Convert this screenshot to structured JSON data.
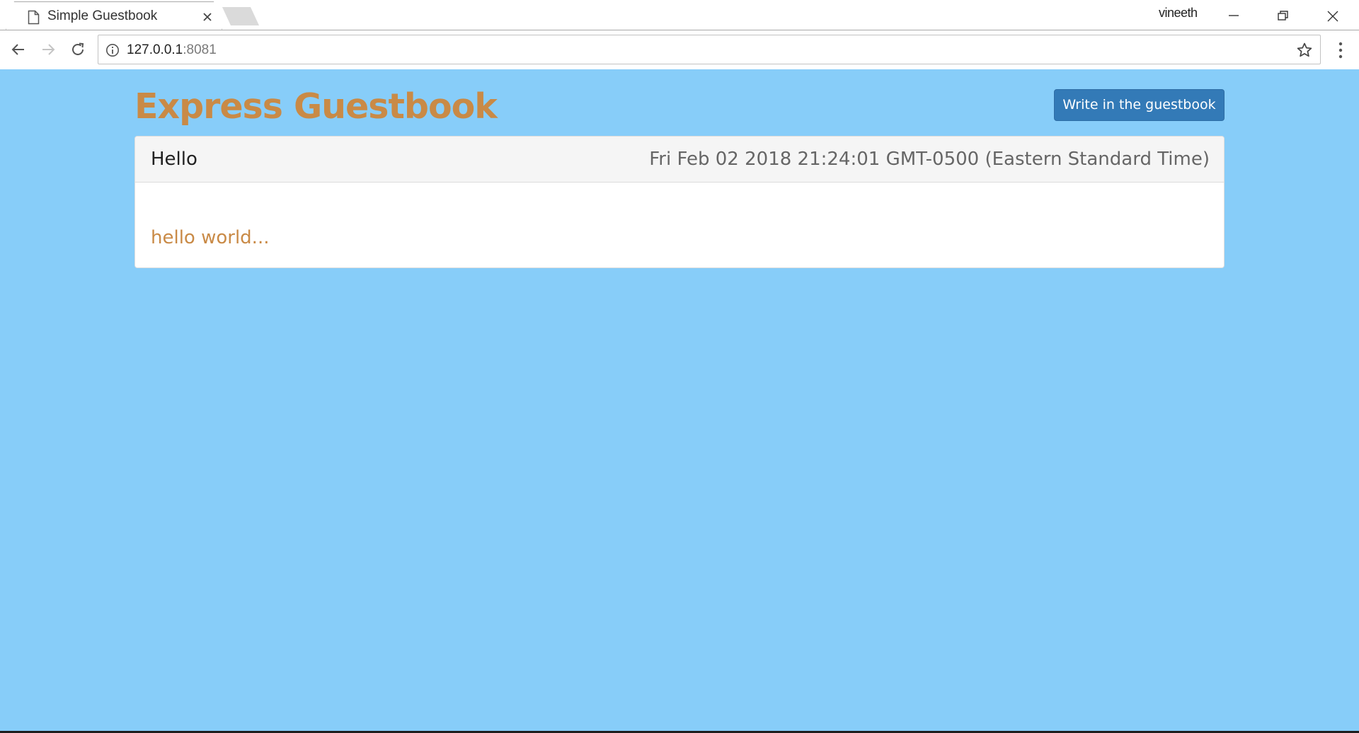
{
  "browser": {
    "tab": {
      "title": "Simple Guestbook"
    },
    "profile_name": "vineeth",
    "address": {
      "host": "127.0.0.1",
      "port": ":8081"
    }
  },
  "page": {
    "title": "Express Guestbook",
    "write_button_label": "Write in the guestbook",
    "entries": [
      {
        "title": "Hello",
        "date": "Fri Feb 02 2018 21:24:01 GMT-0500 (Eastern Standard Time)",
        "body": "hello world..."
      }
    ]
  },
  "colors": {
    "page_background": "#87cdf9",
    "title_accent": "#c98a46",
    "button_primary": "#337ab7"
  },
  "icons": [
    "page-icon",
    "close-icon",
    "minimize-icon",
    "restore-icon",
    "back-arrow-icon",
    "forward-arrow-icon",
    "reload-icon",
    "info-icon",
    "star-icon",
    "kebab-menu-icon"
  ]
}
